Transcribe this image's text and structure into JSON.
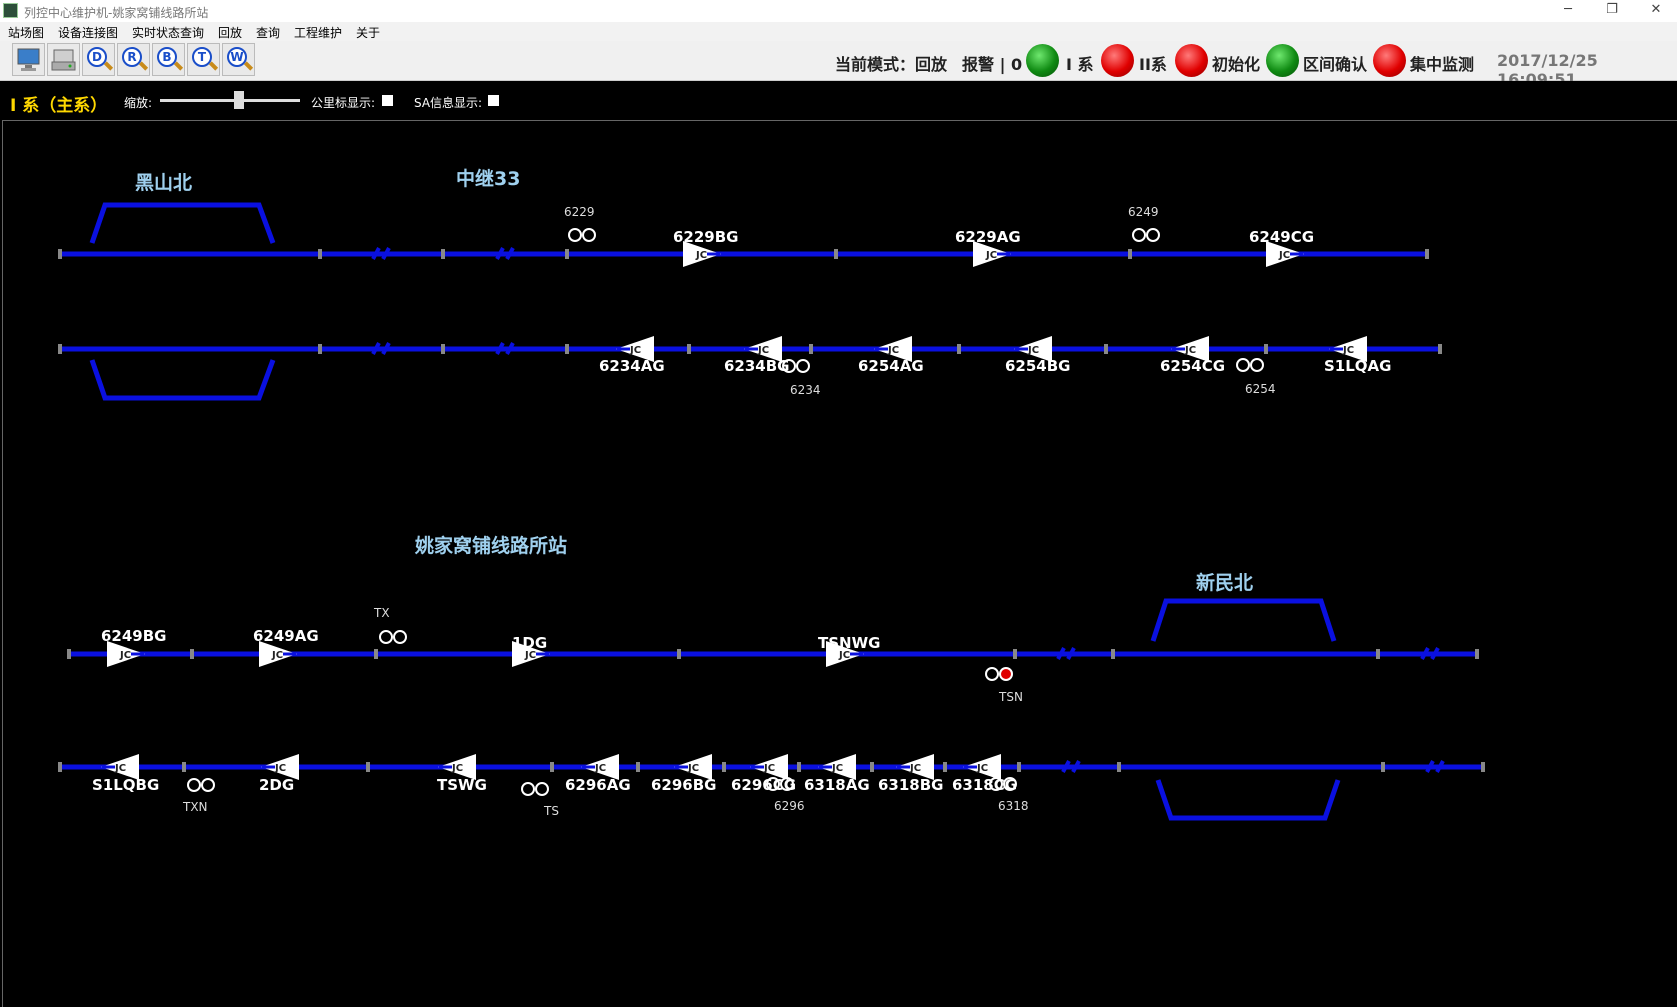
{
  "window": {
    "title": "列控中心维护机-姚家窝铺线路所站",
    "min_glyph": "─",
    "max_glyph": "❐",
    "close_glyph": "✕"
  },
  "menu": [
    "站场图",
    "设备连接图",
    "实时状态查询",
    "回放",
    "查询",
    "工程维护",
    "关于"
  ],
  "toolbar": {
    "buttons": [
      {
        "icon": "monitor-icon",
        "letter": ""
      },
      {
        "icon": "device-icon",
        "letter": ""
      },
      {
        "icon": "magnifier-d-icon",
        "letter": "D"
      },
      {
        "icon": "magnifier-r-icon",
        "letter": "R"
      },
      {
        "icon": "magnifier-b-icon",
        "letter": "B"
      },
      {
        "icon": "magnifier-t-icon",
        "letter": "T"
      },
      {
        "icon": "magnifier-w-icon",
        "letter": "W"
      }
    ]
  },
  "status": {
    "mode": "当前模式：回放",
    "alarm": "报警 | 0",
    "indicators": [
      {
        "label": "I 系",
        "color": "green"
      },
      {
        "label": "II系",
        "color": "red"
      },
      {
        "label": "初始化",
        "color": "red"
      },
      {
        "label": "区间确认",
        "color": "green"
      },
      {
        "label": "集中监测",
        "color": "red"
      }
    ],
    "datetime": "2017/12/25 16:09:51"
  },
  "subbar": {
    "system_label": "I 系（主系）",
    "zoom_label": "缩放:",
    "km_label": "公里标显示:",
    "sa_label": "SA信息显示:"
  },
  "colors": {
    "track": "#0a10e0",
    "station_name": "#9fd0ee",
    "lamp_green": "#10a010",
    "lamp_red": "#e00000"
  },
  "diagram": {
    "stations": {
      "top_left": "黑山北",
      "relay": "中继33",
      "main": "姚家窝铺线路所站",
      "right": "新民北"
    },
    "row1_signals": [
      "6229BG",
      "6229AG",
      "6249CG"
    ],
    "row1_small": [
      "6229",
      "6249"
    ],
    "row2_signals": [
      "6234AG",
      "6234BG",
      "6254AG",
      "6254BG",
      "6254CG",
      "S1LQAG"
    ],
    "row2_small": [
      "6234",
      "6254"
    ],
    "row3_signals": [
      "6249BG",
      "6249AG",
      "1DG",
      "TSNWG"
    ],
    "row3_small": [
      "TX",
      "TSN"
    ],
    "row4_signals": [
      "S1LQBG",
      "2DG",
      "TSWG",
      "6296AG",
      "6296BG",
      "6296CG",
      "6318AG",
      "6318BG",
      "6318CG"
    ],
    "row4_small": [
      "TXN",
      "TS",
      "6296",
      "6318"
    ],
    "marker_text": "JC"
  }
}
